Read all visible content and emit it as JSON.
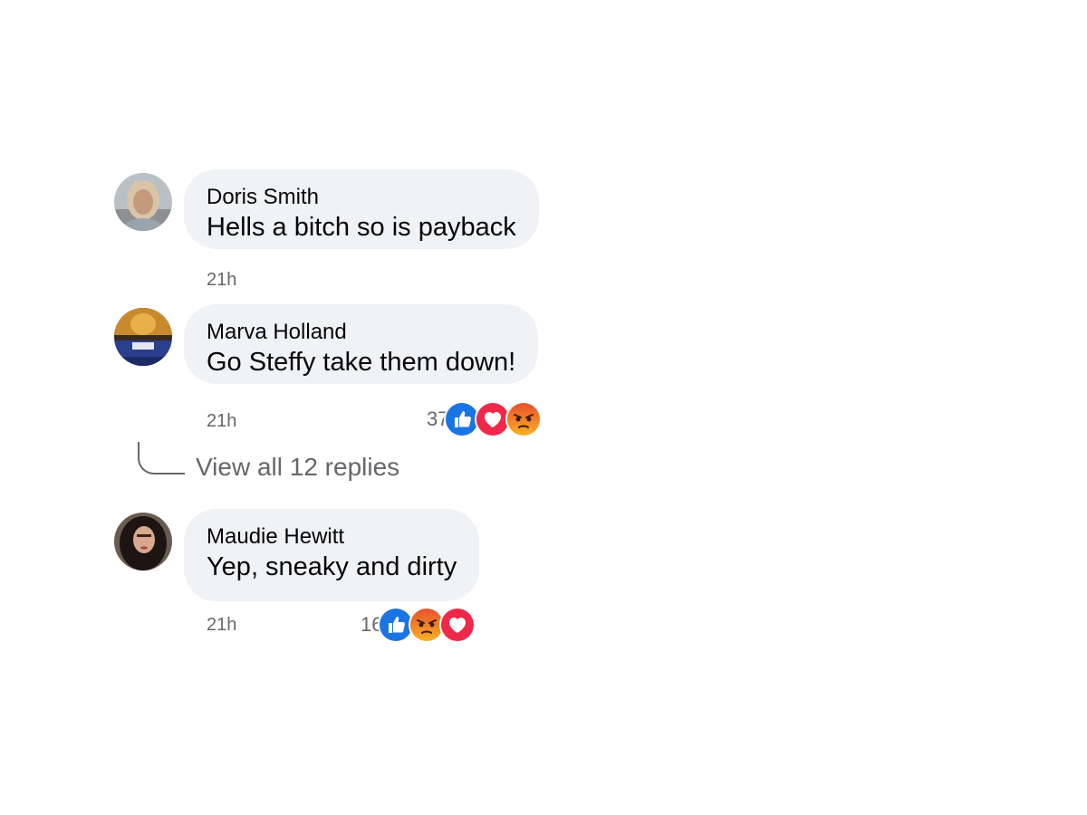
{
  "comments": [
    {
      "author": "Doris Smith",
      "text": "Hells a bitch so is payback",
      "time": "21h",
      "reaction_count": "",
      "reactions": []
    },
    {
      "author": "Marva Holland",
      "text": "Go Steffy take them down!",
      "time": "21h",
      "reaction_count": "37",
      "reactions": [
        "like-icon",
        "love-icon",
        "angry-icon"
      ]
    },
    {
      "author": "Maudie Hewitt",
      "text": "Yep, sneaky and dirty",
      "time": "21h",
      "reaction_count": "16",
      "reactions": [
        "like-icon",
        "angry-icon",
        "love-icon"
      ]
    }
  ],
  "view_replies": {
    "label": "View all 12 replies"
  },
  "colors": {
    "bubble": "#f0f2f5",
    "secondary_text": "#65676b",
    "like_blue": "#1b74e4",
    "love_red": "#f02849",
    "angry_orange": "#f0761e"
  }
}
